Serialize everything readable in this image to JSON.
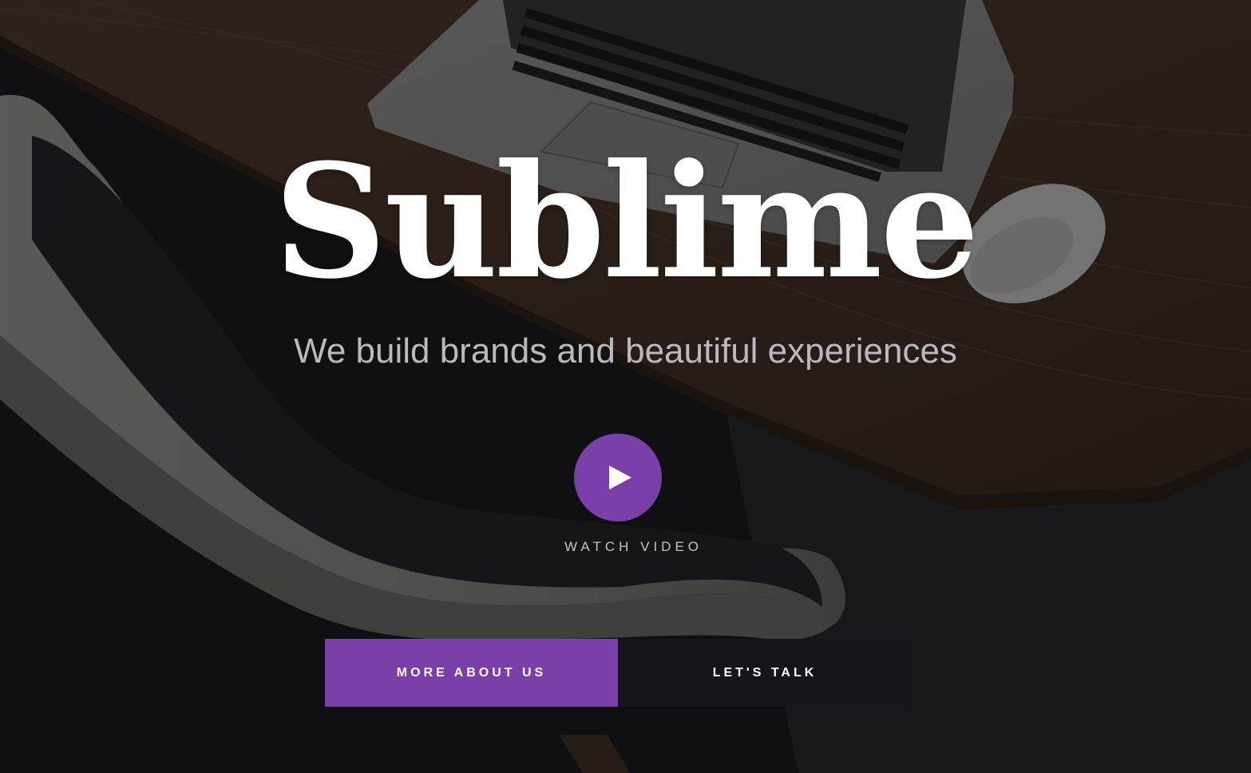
{
  "hero": {
    "title": "Sublime",
    "tagline": "We build brands and beautiful experiences",
    "video": {
      "label": "WATCH VIDEO",
      "icon": "play-icon"
    },
    "buttons": {
      "primary_label": "MORE ABOUT US",
      "secondary_label": "LET'S TALK"
    }
  },
  "colors": {
    "accent": "#7b3fa9",
    "dark_button": "#15161b",
    "background": "#111113",
    "title": "#ffffff",
    "tagline": "#b9b9bf"
  }
}
